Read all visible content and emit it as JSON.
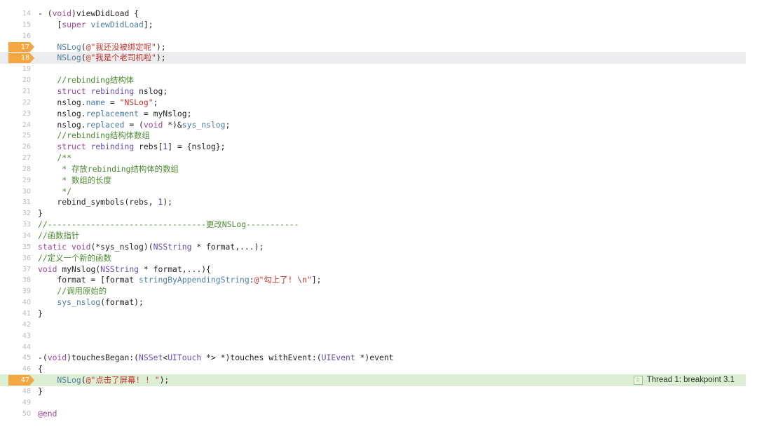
{
  "editor": {
    "lines": [
      {
        "n": "14",
        "tokens": [
          {
            "t": "- (",
            "c": ""
          },
          {
            "t": "void",
            "c": "kw"
          },
          {
            "t": ")viewDidLoad {",
            "c": ""
          }
        ]
      },
      {
        "n": "15",
        "tokens": [
          {
            "t": "    [",
            "c": ""
          },
          {
            "t": "super",
            "c": "kw"
          },
          {
            "t": " viewDidLoad",
            "c": "mem"
          },
          {
            "t": "];",
            "c": ""
          }
        ]
      },
      {
        "n": "16",
        "tokens": []
      },
      {
        "n": "17",
        "bp": "orange",
        "tokens": [
          {
            "t": "    NSLog",
            "c": "mem"
          },
          {
            "t": "(",
            "c": ""
          },
          {
            "t": "@\"我还没被绑定呢\"",
            "c": "str"
          },
          {
            "t": ");",
            "c": ""
          }
        ]
      },
      {
        "n": "18",
        "bp": "orange",
        "current": true,
        "tokens": [
          {
            "t": "    NSLog",
            "c": "mem"
          },
          {
            "t": "(",
            "c": ""
          },
          {
            "t": "@\"我是个老司机啦\"",
            "c": "str"
          },
          {
            "t": ");",
            "c": ""
          }
        ]
      },
      {
        "n": "19",
        "tokens": []
      },
      {
        "n": "20",
        "tokens": [
          {
            "t": "    //rebinding结构体",
            "c": "cm"
          }
        ]
      },
      {
        "n": "21",
        "tokens": [
          {
            "t": "    ",
            "c": ""
          },
          {
            "t": "struct",
            "c": "kw"
          },
          {
            "t": " ",
            "c": ""
          },
          {
            "t": "rebinding",
            "c": "ty"
          },
          {
            "t": " nslog;",
            "c": ""
          }
        ]
      },
      {
        "n": "22",
        "tokens": [
          {
            "t": "    nslog.",
            "c": ""
          },
          {
            "t": "name",
            "c": "mem"
          },
          {
            "t": " = ",
            "c": ""
          },
          {
            "t": "\"NSLog\"",
            "c": "str"
          },
          {
            "t": ";",
            "c": ""
          }
        ]
      },
      {
        "n": "23",
        "tokens": [
          {
            "t": "    nslog.",
            "c": ""
          },
          {
            "t": "replacement",
            "c": "mem"
          },
          {
            "t": " = myNslog;",
            "c": ""
          }
        ]
      },
      {
        "n": "24",
        "tokens": [
          {
            "t": "    nslog.",
            "c": ""
          },
          {
            "t": "replaced",
            "c": "mem"
          },
          {
            "t": " = (",
            "c": ""
          },
          {
            "t": "void",
            "c": "kw"
          },
          {
            "t": " *)&",
            "c": ""
          },
          {
            "t": "sys_nslog",
            "c": "mem"
          },
          {
            "t": ";",
            "c": ""
          }
        ]
      },
      {
        "n": "25",
        "tokens": [
          {
            "t": "    //rebinding结构体数组",
            "c": "cm"
          }
        ]
      },
      {
        "n": "26",
        "tokens": [
          {
            "t": "    ",
            "c": ""
          },
          {
            "t": "struct",
            "c": "kw"
          },
          {
            "t": " ",
            "c": ""
          },
          {
            "t": "rebinding",
            "c": "ty"
          },
          {
            "t": " rebs[",
            "c": ""
          },
          {
            "t": "1",
            "c": "num"
          },
          {
            "t": "] = {nslog};",
            "c": ""
          }
        ]
      },
      {
        "n": "27",
        "tokens": [
          {
            "t": "    /**",
            "c": "cm"
          }
        ]
      },
      {
        "n": "28",
        "tokens": [
          {
            "t": "     * 存放rebinding结构体的数组",
            "c": "cm"
          }
        ]
      },
      {
        "n": "29",
        "tokens": [
          {
            "t": "     * 数组的长度",
            "c": "cm"
          }
        ]
      },
      {
        "n": "30",
        "tokens": [
          {
            "t": "     */",
            "c": "cm"
          }
        ]
      },
      {
        "n": "31",
        "tokens": [
          {
            "t": "    rebind_symbols(rebs, ",
            "c": ""
          },
          {
            "t": "1",
            "c": "num"
          },
          {
            "t": ");",
            "c": ""
          }
        ]
      },
      {
        "n": "32",
        "tokens": [
          {
            "t": "}",
            "c": ""
          }
        ]
      },
      {
        "n": "33",
        "tokens": [
          {
            "t": "//---------------------------------更改NSLog-----------",
            "c": "cm"
          }
        ]
      },
      {
        "n": "34",
        "tokens": [
          {
            "t": "//函数指针",
            "c": "cm"
          }
        ]
      },
      {
        "n": "35",
        "tokens": [
          {
            "t": "static",
            "c": "kw"
          },
          {
            "t": " ",
            "c": ""
          },
          {
            "t": "void",
            "c": "kw"
          },
          {
            "t": "(*sys_nslog)(",
            "c": ""
          },
          {
            "t": "NSString",
            "c": "ty"
          },
          {
            "t": " * format,...);",
            "c": ""
          }
        ]
      },
      {
        "n": "36",
        "tokens": [
          {
            "t": "//定义一个新的函数",
            "c": "cm"
          }
        ]
      },
      {
        "n": "37",
        "tokens": [
          {
            "t": "void",
            "c": "kw"
          },
          {
            "t": " myNslog(",
            "c": ""
          },
          {
            "t": "NSString",
            "c": "ty"
          },
          {
            "t": " * format,...){",
            "c": ""
          }
        ]
      },
      {
        "n": "38",
        "tokens": [
          {
            "t": "    format = [format ",
            "c": ""
          },
          {
            "t": "stringByAppendingString",
            "c": "mem"
          },
          {
            "t": ":",
            "c": ""
          },
          {
            "t": "@\"勾上了! \\n\"",
            "c": "str"
          },
          {
            "t": "];",
            "c": ""
          }
        ]
      },
      {
        "n": "39",
        "tokens": [
          {
            "t": "    //调用原始的",
            "c": "cm"
          }
        ]
      },
      {
        "n": "40",
        "tokens": [
          {
            "t": "    ",
            "c": ""
          },
          {
            "t": "sys_nslog",
            "c": "mem"
          },
          {
            "t": "(format);",
            "c": ""
          }
        ]
      },
      {
        "n": "41",
        "tokens": [
          {
            "t": "}",
            "c": ""
          }
        ]
      },
      {
        "n": "42",
        "tokens": []
      },
      {
        "n": "43",
        "tokens": []
      },
      {
        "n": "44",
        "tokens": []
      },
      {
        "n": "45",
        "tokens": [
          {
            "t": "-(",
            "c": ""
          },
          {
            "t": "void",
            "c": "kw"
          },
          {
            "t": ")touchesBegan:(",
            "c": ""
          },
          {
            "t": "NSSet",
            "c": "ty"
          },
          {
            "t": "<",
            "c": ""
          },
          {
            "t": "UITouch",
            "c": "ty"
          },
          {
            "t": " *> *)touches withEvent:(",
            "c": ""
          },
          {
            "t": "UIEvent",
            "c": "ty"
          },
          {
            "t": " *)event",
            "c": ""
          }
        ]
      },
      {
        "n": "46",
        "tokens": [
          {
            "t": "{",
            "c": ""
          }
        ]
      },
      {
        "n": "47",
        "bp": "orange",
        "hit": true,
        "tokens": [
          {
            "t": "    NSLog",
            "c": "mem"
          },
          {
            "t": "(",
            "c": ""
          },
          {
            "t": "@\"点击了屏幕! ! \"",
            "c": "str"
          },
          {
            "t": ");",
            "c": ""
          }
        ]
      },
      {
        "n": "48",
        "tokens": [
          {
            "t": "}",
            "c": ""
          }
        ]
      },
      {
        "n": "49",
        "tokens": []
      },
      {
        "n": "50",
        "tokens": [
          {
            "t": "@end",
            "c": "kw"
          }
        ]
      }
    ]
  },
  "thread_badge": {
    "icon": "equals-icon",
    "label": "Thread 1: breakpoint 3.1"
  },
  "colors": {
    "breakpoint": "#f4a640",
    "current_line": "#ececef",
    "hit_line": "#dcefd4"
  }
}
